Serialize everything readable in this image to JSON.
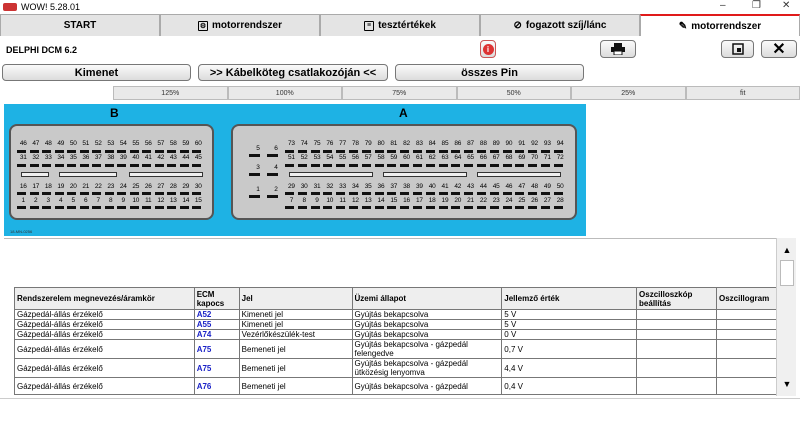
{
  "app": {
    "title": "WOW! 5.28.01"
  },
  "window_controls": {
    "minimize": "–",
    "maximize": "❐",
    "close": "✕"
  },
  "tabs": [
    {
      "label": "START"
    },
    {
      "label": "motorrendszer"
    },
    {
      "label": "tesztértékek"
    },
    {
      "label": "fogazott szíj/lánc"
    },
    {
      "label": "motorrendszer"
    }
  ],
  "header": {
    "module": "DELPHI DCM 6.2",
    "info_icon": "i"
  },
  "nav": {
    "output": "Kimenet",
    "harness": ">> Kábelköteg csatlakozóján <<",
    "all_pins": "összes Pin"
  },
  "zoom": [
    "125%",
    "100%",
    "75%",
    "50%",
    "25%",
    "fit"
  ],
  "connectors": {
    "b_label": "B",
    "a_label": "A",
    "b_rows": [
      [
        "46",
        "47",
        "48",
        "49",
        "50",
        "51",
        "52",
        "53",
        "54",
        "55",
        "56",
        "57",
        "58",
        "59",
        "60"
      ],
      [
        "31",
        "32",
        "33",
        "34",
        "35",
        "36",
        "37",
        "38",
        "39",
        "40",
        "41",
        "42",
        "43",
        "44",
        "45"
      ],
      [
        "16",
        "17",
        "18",
        "19",
        "20",
        "21",
        "22",
        "23",
        "24",
        "25",
        "26",
        "27",
        "28",
        "29",
        "30"
      ],
      [
        "1",
        "2",
        "3",
        "4",
        "5",
        "6",
        "7",
        "8",
        "9",
        "10",
        "11",
        "12",
        "13",
        "14",
        "15"
      ]
    ],
    "a_rows": [
      [
        "73",
        "74",
        "75",
        "76",
        "77",
        "78",
        "79",
        "80",
        "81",
        "82",
        "83",
        "84",
        "85",
        "86",
        "87",
        "88",
        "89",
        "90",
        "91",
        "92",
        "93",
        "94"
      ],
      [
        "51",
        "52",
        "53",
        "54",
        "55",
        "56",
        "57",
        "58",
        "59",
        "60",
        "61",
        "62",
        "63",
        "64",
        "65",
        "66",
        "67",
        "68",
        "69",
        "70",
        "71",
        "72"
      ],
      [
        "29",
        "30",
        "31",
        "32",
        "33",
        "34",
        "35",
        "36",
        "37",
        "38",
        "39",
        "40",
        "41",
        "42",
        "43",
        "44",
        "45",
        "46",
        "47",
        "48",
        "49",
        "50"
      ],
      [
        "7",
        "8",
        "9",
        "10",
        "11",
        "12",
        "13",
        "14",
        "15",
        "16",
        "17",
        "18",
        "19",
        "20",
        "21",
        "22",
        "23",
        "24",
        "25",
        "26",
        "27",
        "28"
      ]
    ],
    "a_small": [
      [
        "5",
        "6"
      ],
      [
        "3",
        "4"
      ],
      [
        "1",
        "2"
      ]
    ],
    "footnote": "18-MN-0256"
  },
  "table": {
    "headers": [
      "Rendszerelem megnevezés/áramkör",
      "ECM kapocs",
      "Jel",
      "Üzemi állapot",
      "Jellemző érték",
      "Oszcilloszkóp beállítás",
      "Oszcillogram"
    ],
    "rows": [
      [
        "Gázpedál-állás érzékelő",
        "A52",
        "Kimeneti jel",
        "Gyújtás bekapcsolva",
        "5 V",
        "",
        ""
      ],
      [
        "Gázpedál-állás érzékelő",
        "A55",
        "Kimeneti jel",
        "Gyújtás bekapcsolva",
        "5 V",
        "",
        ""
      ],
      [
        "Gázpedál-állás érzékelő",
        "A74",
        "Vezérlőkészülék-test",
        "Gyújtás bekapcsolva",
        "0 V",
        "",
        ""
      ],
      [
        "Gázpedál-állás érzékelő",
        "A75",
        "Bemeneti jel",
        "Gyújtás bekapcsolva - gázpedál felengedve",
        "0,7 V",
        "",
        ""
      ],
      [
        "Gázpedál-állás érzékelő",
        "A75",
        "Bemeneti jel",
        "Gyújtás bekapcsolva - gázpedál ütközésig lenyomva",
        "4,4 V",
        "",
        ""
      ],
      [
        "Gázpedál-állás érzékelő",
        "A76",
        "Bemeneti jel",
        "Gyújtás bekapcsolva - gázpedál",
        "0,4 V",
        "",
        ""
      ]
    ]
  },
  "icons": {
    "tab2": "engine-icon",
    "tab3": "document-icon",
    "tab4": "belt-icon",
    "tab5": "wrench-icon",
    "print": "printer-icon",
    "window": "window-icon",
    "close": "close-icon"
  },
  "colors": {
    "accent": "#e01a1a",
    "diagram_bg": "#1eb2e4",
    "code_link": "#1a22c7"
  }
}
